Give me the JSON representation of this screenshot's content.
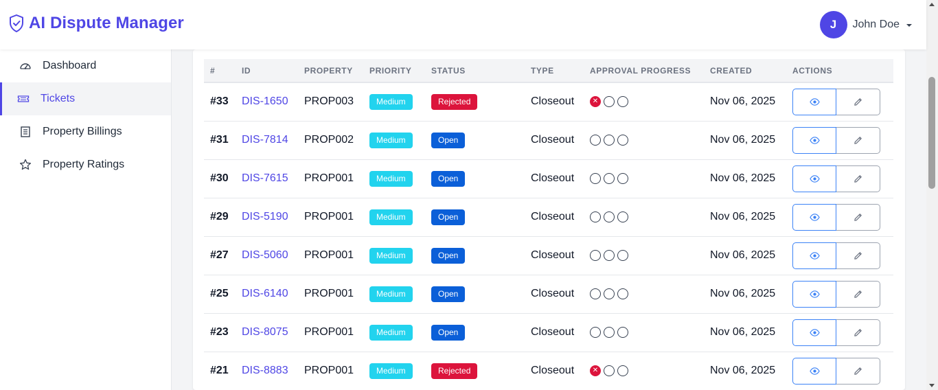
{
  "app": {
    "title": "AI Dispute Manager"
  },
  "user": {
    "initial": "J",
    "name": "John Doe"
  },
  "sidebar": {
    "items": [
      {
        "label": "Dashboard",
        "icon": "speedometer-icon",
        "active": false
      },
      {
        "label": "Tickets",
        "icon": "ticket-icon",
        "active": true
      },
      {
        "label": "Property Billings",
        "icon": "receipt-icon",
        "active": false
      },
      {
        "label": "Property Ratings",
        "icon": "star-icon",
        "active": false
      }
    ]
  },
  "table": {
    "columns": [
      "#",
      "ID",
      "PROPERTY",
      "PRIORITY",
      "STATUS",
      "TYPE",
      "APPROVAL PROGRESS",
      "CREATED",
      "ACTIONS"
    ],
    "rows": [
      {
        "num": "#33",
        "id": "DIS-1650",
        "property": "PROP003",
        "priority": "Medium",
        "status": "Rejected",
        "type": "Closeout",
        "created": "Nov 06, 2025"
      },
      {
        "num": "#31",
        "id": "DIS-7814",
        "property": "PROP002",
        "priority": "Medium",
        "status": "Open",
        "type": "Closeout",
        "created": "Nov 06, 2025"
      },
      {
        "num": "#30",
        "id": "DIS-7615",
        "property": "PROP001",
        "priority": "Medium",
        "status": "Open",
        "type": "Closeout",
        "created": "Nov 06, 2025"
      },
      {
        "num": "#29",
        "id": "DIS-5190",
        "property": "PROP001",
        "priority": "Medium",
        "status": "Open",
        "type": "Closeout",
        "created": "Nov 06, 2025"
      },
      {
        "num": "#27",
        "id": "DIS-5060",
        "property": "PROP001",
        "priority": "Medium",
        "status": "Open",
        "type": "Closeout",
        "created": "Nov 06, 2025"
      },
      {
        "num": "#25",
        "id": "DIS-6140",
        "property": "PROP001",
        "priority": "Medium",
        "status": "Open",
        "type": "Closeout",
        "created": "Nov 06, 2025"
      },
      {
        "num": "#23",
        "id": "DIS-8075",
        "property": "PROP001",
        "priority": "Medium",
        "status": "Open",
        "type": "Closeout",
        "created": "Nov 06, 2025"
      },
      {
        "num": "#21",
        "id": "DIS-8883",
        "property": "PROP001",
        "priority": "Medium",
        "status": "Rejected",
        "type": "Closeout",
        "created": "Nov 06, 2025"
      }
    ]
  },
  "colors": {
    "brand": "#4f46e5",
    "medium_badge": "#22d3ee",
    "open_badge": "#0b5fd8",
    "rejected_badge": "#dc143c"
  }
}
